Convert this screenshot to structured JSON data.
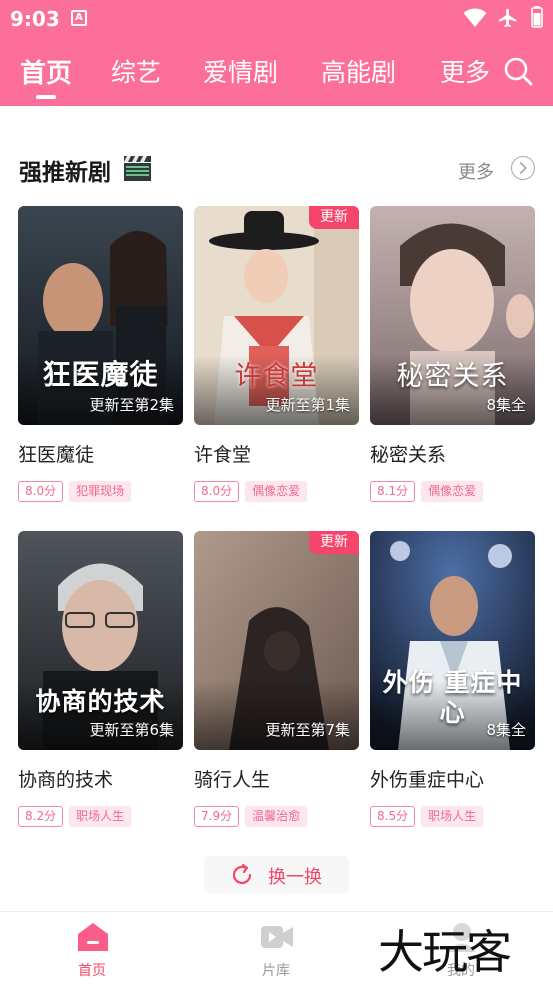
{
  "status_bar": {
    "time": "9:03",
    "notification_icon": "A"
  },
  "tabs": [
    {
      "label": "首页",
      "active": true
    },
    {
      "label": "综艺",
      "active": false
    },
    {
      "label": "爱情剧",
      "active": false
    },
    {
      "label": "高能剧",
      "active": false
    },
    {
      "label": "更多",
      "active": false
    }
  ],
  "section": {
    "title": "强推新剧",
    "title_icon": "clapper-board-icon",
    "more_label": "更多"
  },
  "cards": [
    {
      "title": "狂医魔徒",
      "poster_text": "狂医魔徒",
      "episode": "更新至第2集",
      "badge": "",
      "score": "8.0分",
      "genre": "犯罪现场"
    },
    {
      "title": "许食堂",
      "poster_text": "许食堂",
      "episode": "更新至第1集",
      "badge": "更新",
      "score": "8.0分",
      "genre": "偶像恋爱"
    },
    {
      "title": "秘密关系",
      "poster_text": "秘密关系",
      "episode": "8集全",
      "badge": "",
      "score": "8.1分",
      "genre": "偶像恋爱"
    },
    {
      "title": "协商的技术",
      "poster_text": "协商的技术",
      "episode": "更新至第6集",
      "badge": "",
      "score": "8.2分",
      "genre": "职场人生"
    },
    {
      "title": "骑行人生",
      "poster_text": "",
      "episode": "更新至第7集",
      "badge": "更新",
      "score": "7.9分",
      "genre": "温馨治愈"
    },
    {
      "title": "外伤重症中心",
      "poster_text": "外伤 重症中心",
      "episode": "8集全",
      "badge": "",
      "score": "8.5分",
      "genre": "职场人生"
    }
  ],
  "refresh": {
    "label": "换一换"
  },
  "bottom_nav": [
    {
      "label": "首页",
      "icon": "home-icon",
      "active": true
    },
    {
      "label": "片库",
      "icon": "video-library-icon",
      "active": false
    },
    {
      "label": "我的",
      "icon": "profile-icon",
      "active": false
    }
  ],
  "watermark": "大玩客",
  "colors": {
    "brand": "#fc6f9a",
    "accent": "#f5456a",
    "tag_bg": "#fde6ee"
  }
}
